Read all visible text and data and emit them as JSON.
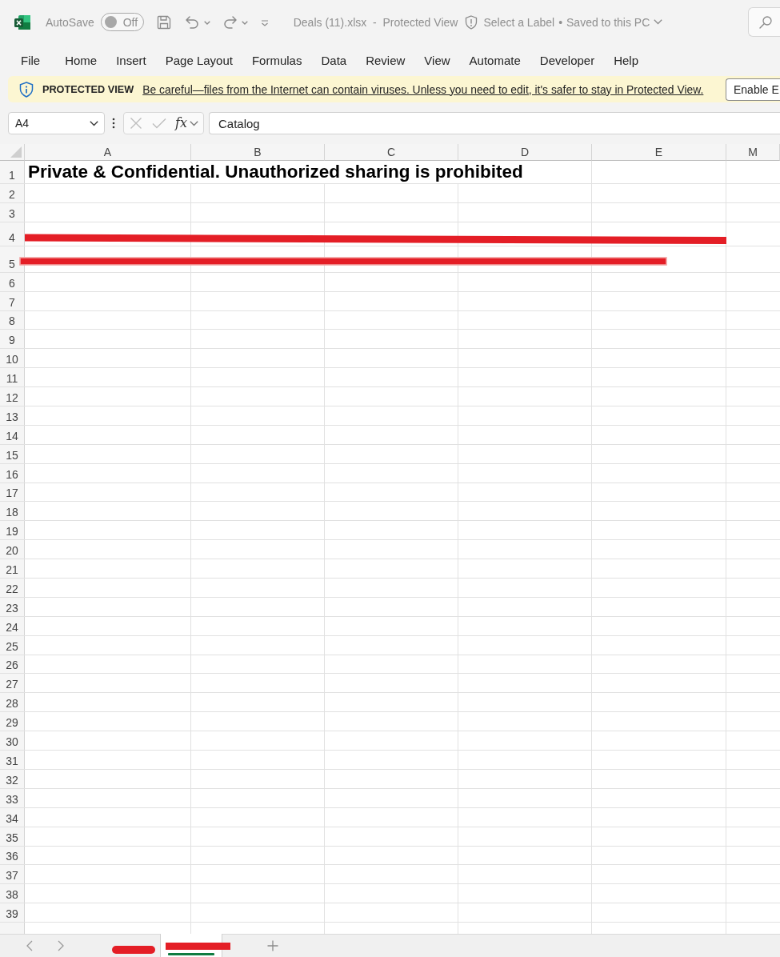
{
  "title_bar": {
    "autosave": {
      "label": "AutoSave",
      "on": false,
      "state_label": "Off"
    },
    "document": "Deals (11).xlsx  -  Protected View",
    "sensitivity": "Select a Label",
    "separator": "•",
    "save_status": "Saved to this PC"
  },
  "menu": [
    "File",
    "Home",
    "Insert",
    "Page Layout",
    "Formulas",
    "Data",
    "Review",
    "View",
    "Automate",
    "Developer",
    "Help"
  ],
  "protected_view": {
    "title": "PROTECTED VIEW",
    "message": "Be careful—files from the Internet can contain viruses. Unless you need to edit, it's safer to stay in Protected View.",
    "button": "Enable E"
  },
  "formula_bar": {
    "name_box": "A4",
    "function_label": "fx",
    "value": "Catalog"
  },
  "sheet": {
    "columns": [
      "A",
      "B",
      "C",
      "D",
      "E",
      "M"
    ],
    "rows": [
      {
        "header": "1",
        "cells": [
          "Private & Confidential. Unauthorized sharing is prohibited"
        ]
      },
      {
        "header": "2"
      },
      {
        "header": "3"
      },
      {
        "header": "4",
        "redaction": {
          "kind": "slanted"
        }
      },
      {
        "header": "5",
        "redaction": {
          "kind": "outlined"
        }
      },
      {
        "header": "6"
      },
      {
        "header": "7"
      },
      {
        "header": "8"
      },
      {
        "header": "9"
      },
      {
        "header": "10"
      },
      {
        "header": "11"
      },
      {
        "header": "12"
      },
      {
        "header": "13"
      },
      {
        "header": "14"
      },
      {
        "header": "15"
      },
      {
        "header": "16"
      },
      {
        "header": "17"
      },
      {
        "header": "18"
      },
      {
        "header": "19"
      },
      {
        "header": "20"
      },
      {
        "header": "21"
      },
      {
        "header": "22"
      },
      {
        "header": "23"
      },
      {
        "header": "24"
      },
      {
        "header": "25"
      },
      {
        "header": "26"
      },
      {
        "header": "27"
      },
      {
        "header": "28"
      },
      {
        "header": "29"
      },
      {
        "header": "30"
      },
      {
        "header": "31"
      },
      {
        "header": "32"
      },
      {
        "header": "33"
      },
      {
        "header": "34"
      },
      {
        "header": "35"
      },
      {
        "header": "36"
      },
      {
        "header": "37"
      },
      {
        "header": "38"
      },
      {
        "header": "39"
      }
    ]
  },
  "sheet_tabs": {
    "tabs": [
      {
        "selected": false,
        "redaction": {
          "kind": "blob"
        }
      },
      {
        "selected": true,
        "redaction": {
          "kind": "bar"
        }
      }
    ]
  }
}
